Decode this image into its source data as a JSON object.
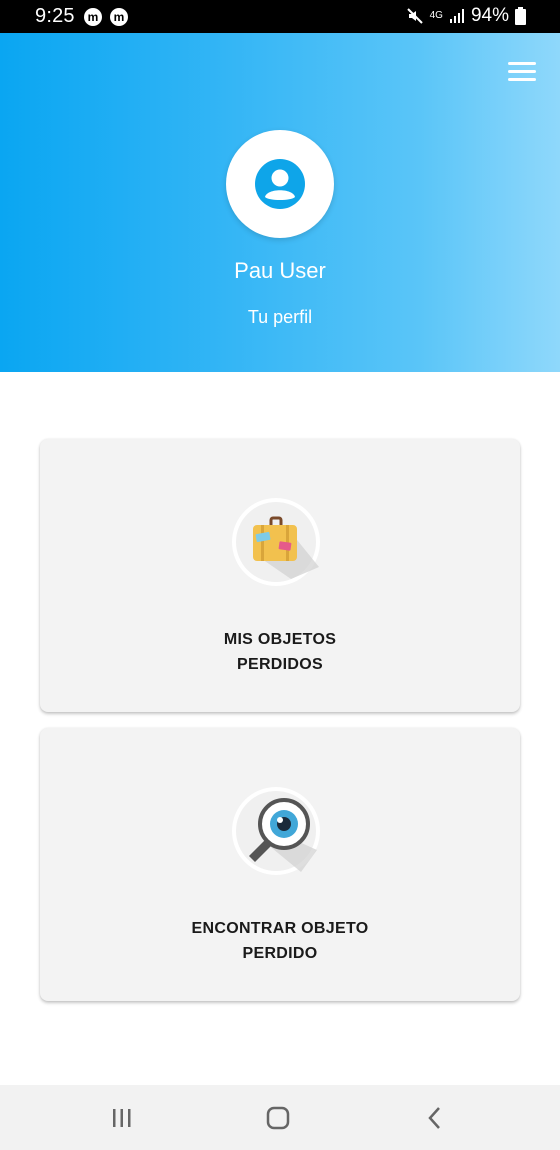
{
  "status_bar": {
    "time": "9:25",
    "app_icon_1": "m",
    "app_icon_2": "m",
    "network": "4G",
    "battery": "94%"
  },
  "header": {
    "user_name": "Pau User",
    "profile_link": "Tu perfil"
  },
  "cards": [
    {
      "label_line1": "MIS OBJETOS",
      "label_line2": "PERDIDOS",
      "icon": "suitcase-icon"
    },
    {
      "label_line1": "ENCONTRAR OBJETO",
      "label_line2": "PERDIDO",
      "icon": "magnifier-eye-icon"
    }
  ],
  "colors": {
    "header_start": "#0aa6f2",
    "header_end": "#8fd8fb",
    "avatar_icon": "#0ea5e9",
    "card_bg": "#f3f3f3"
  }
}
